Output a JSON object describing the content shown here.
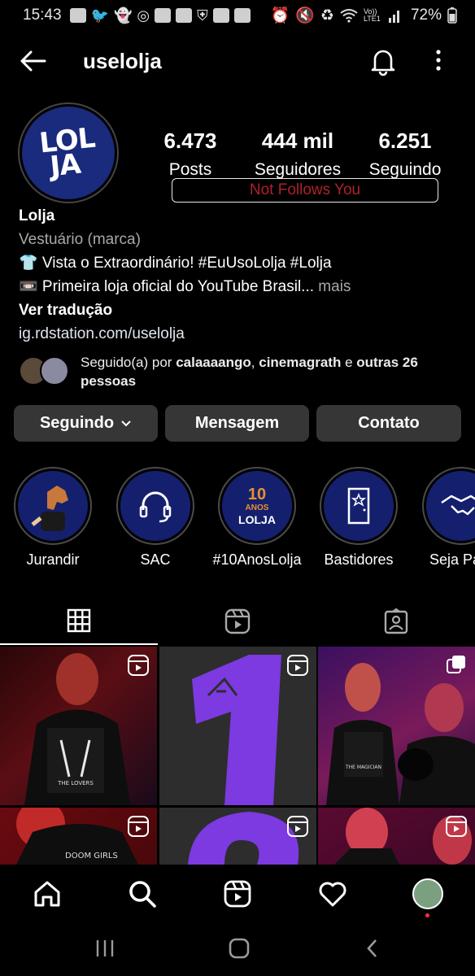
{
  "status_bar": {
    "time": "15:43",
    "network_label": "Vo)) LTE1",
    "battery": "72%"
  },
  "header": {
    "username": "uselolja",
    "back_icon": "arrow-left-icon",
    "notification_icon": "bell-icon",
    "more_icon": "more-vertical-icon"
  },
  "profile": {
    "avatar_text_line1": "LOL",
    "avatar_text_line2": "JA",
    "stats": [
      {
        "value": "6.473",
        "label": "Posts"
      },
      {
        "value": "444 mil",
        "label": "Seguidores"
      },
      {
        "value": "6.251",
        "label": "Seguindo"
      }
    ],
    "not_follows_you": "Not Follows You",
    "name": "Lolja",
    "category": "Vestuário (marca)",
    "bio_line1": "👕 Vista o Extraordinário! #EuUsoLolja #Lolja",
    "bio_line2": "📼 Primeira loja oficial do YouTube Brasil...",
    "bio_more": " mais",
    "see_translation": "Ver tradução",
    "link": "ig.rdstation.com/uselolja",
    "followed_by_prefix": "Seguido(a) por ",
    "followed_by_user1": "calaaaango",
    "followed_by_sep": ", ",
    "followed_by_user2": "cinemagrath",
    "followed_by_and": " e ",
    "followed_by_others": "outras 26 pessoas"
  },
  "actions": {
    "following": "Seguindo",
    "message": "Mensagem",
    "contact": "Contato"
  },
  "highlights": [
    {
      "label": "Jurandir"
    },
    {
      "label": "SAC"
    },
    {
      "label": "#10AnosLolja"
    },
    {
      "label": "Bastidores"
    },
    {
      "label": "Seja Parc"
    }
  ],
  "highlight_art": {
    "ten": "10",
    "anos": "ANOS",
    "lolja": "LOLJA"
  },
  "tabs": [
    {
      "icon": "grid-icon",
      "selected": true
    },
    {
      "icon": "reels-icon",
      "selected": false
    },
    {
      "icon": "tagged-icon",
      "selected": false
    }
  ],
  "posts": [
    {
      "type": "reel",
      "caption_text": "THE LOVERS"
    },
    {
      "type": "reel",
      "caption_text": "1"
    },
    {
      "type": "carousel",
      "caption_text": "THE MAGICIAN"
    },
    {
      "type": "reel",
      "caption_text": "DOOM GIRLS"
    },
    {
      "type": "reel",
      "caption_text": "2"
    },
    {
      "type": "reel",
      "caption_text": ""
    }
  ],
  "bottom_nav": [
    "home-icon",
    "search-icon",
    "reels-icon",
    "heart-icon",
    "profile-avatar"
  ],
  "system_nav": [
    "recent-apps-icon",
    "home-button-icon",
    "back-icon"
  ]
}
